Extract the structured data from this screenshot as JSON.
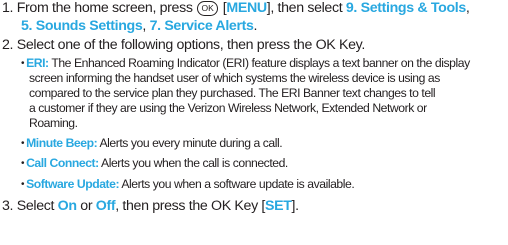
{
  "ok_key_symbol": "OK",
  "accent_color": "#29a8e0",
  "text_color": "#231f20",
  "steps": [
    {
      "number": "1.",
      "text_a": "From the home screen, press",
      "bracket_open": "[",
      "menu": "MENU",
      "bracket_close": "]",
      "text_b": ", then select ",
      "settings": "9. Settings & Tools",
      "comma": ",",
      "sounds": "5. Sounds Settings",
      "comma2": ", ",
      "alerts": "7. Service Alerts",
      "period": "."
    },
    {
      "number": "2.",
      "text": "Select one of the following options, then press the OK Key."
    },
    {
      "number": "3.",
      "text_a": "Select ",
      "on": "On",
      "or": " or ",
      "off": "Off",
      "text_b": ", then press the OK Key [",
      "set": "SET",
      "end": "]."
    }
  ],
  "options": [
    {
      "label": "ERI:",
      "lines": [
        "The Enhanced Roaming Indicator (ERI) feature displays a text banner on the display",
        "screen informing the handset user of which systems the wireless device is using as",
        "compared to the service plan they purchased. The ERI Banner text changes to tell",
        "a customer if they are using the Verizon Wireless Network, Extended Network or",
        "Roaming."
      ]
    },
    {
      "label": "Minute Beep:",
      "text": "Alerts you every minute during a call."
    },
    {
      "label": "Call Connect:",
      "text": "Alerts you when the call is connected."
    },
    {
      "label": "Software Update:",
      "text": "Alerts you when a software update is available."
    }
  ]
}
